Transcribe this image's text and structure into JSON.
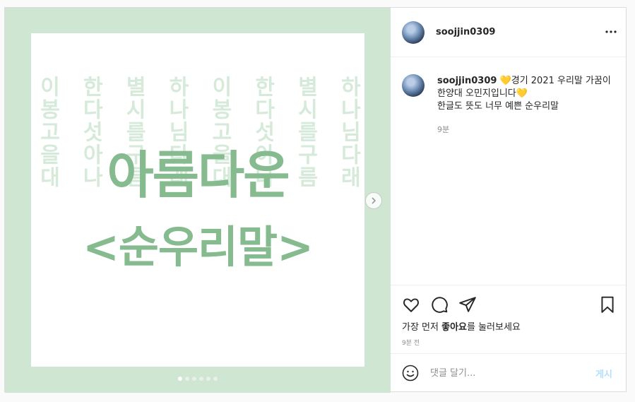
{
  "post": {
    "username": "soojjin0309",
    "more_icon": "more-horizontal-icon",
    "media": {
      "title_line1": "아름다운",
      "title_line2": "<순우리말>",
      "background_glyphs": [
        "이봉고을대",
        "한다섯아나",
        "별시를구름",
        "하나님다래",
        "이봉고을대",
        "한다섯아나",
        "별시를구름",
        "하나님다래"
      ],
      "next_icon": "chevron-right-icon",
      "slide_count": 6,
      "active_slide": 1
    },
    "caption": {
      "username": "soojjin0309",
      "heart1": "💛",
      "text1": "경기 2021 우리말 가꿈이 한양대 오민지입니다",
      "heart2": "💛",
      "text2": "한글도 뜻도 너무 예쁜 순우리말",
      "time": "9분"
    },
    "actions": {
      "like_icon": "heart-icon",
      "comment_icon": "comment-icon",
      "share_icon": "send-icon",
      "save_icon": "bookmark-icon",
      "likes_prefix": "가장 먼저 ",
      "likes_bold": "좋아요",
      "likes_suffix": "를 눌러보세요",
      "time": "9분 전"
    },
    "comment": {
      "emoji_icon": "smiley-icon",
      "placeholder": "댓글 달기...",
      "post_label": "게시"
    },
    "colors": {
      "media_background": "#cfe6d3",
      "title_green": "#86bb8f",
      "post_button": "#b2dffc",
      "heart_yellow": "#f5d90a"
    }
  }
}
